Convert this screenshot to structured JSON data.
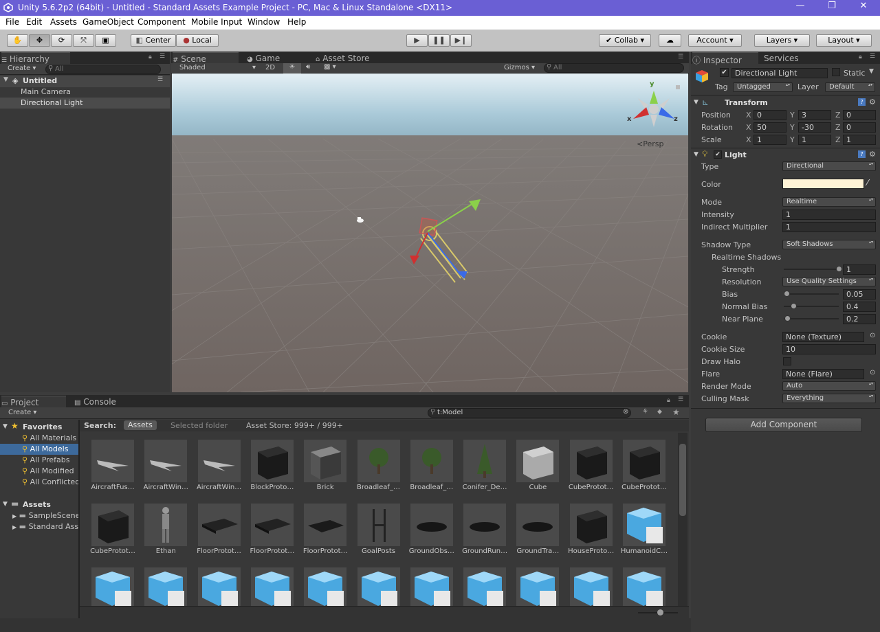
{
  "window": {
    "title": "Unity 5.6.2p2 (64bit) - Untitled - Standard Assets Example Project - PC, Mac & Linux Standalone <DX11>",
    "minimize": "—",
    "maximize": "❐",
    "close": "✕"
  },
  "menubar": [
    "File",
    "Edit",
    "Assets",
    "GameObject",
    "Component",
    "Mobile Input",
    "Window",
    "Help"
  ],
  "toolbar": {
    "pivot": "Center",
    "space": "Local",
    "collab": "Collab",
    "account": "Account",
    "layers": "Layers",
    "layout": "Layout"
  },
  "hierarchy": {
    "tab": "Hierarchy",
    "create": "Create",
    "search_placeholder": "All",
    "scene": "Untitled",
    "items": [
      "Main Camera",
      "Directional Light"
    ],
    "selected": "Directional Light"
  },
  "scene": {
    "tabs": [
      "Scene",
      "Game",
      "Asset Store"
    ],
    "shading": "Shaded",
    "mode_2d": "2D",
    "gizmos": "Gizmos",
    "search_placeholder": "All",
    "projection": "Persp",
    "axes": {
      "x": "x",
      "y": "y",
      "z": "z"
    }
  },
  "inspector": {
    "tabs": [
      "Inspector",
      "Services"
    ],
    "object_name": "Directional Light",
    "static_label": "Static",
    "tag_label": "Tag",
    "tag_value": "Untagged",
    "layer_label": "Layer",
    "layer_value": "Default",
    "transform": {
      "title": "Transform",
      "rows": [
        {
          "label": "Position",
          "x": "0",
          "y": "3",
          "z": "0"
        },
        {
          "label": "Rotation",
          "x": "50",
          "y": "-30",
          "z": "0"
        },
        {
          "label": "Scale",
          "x": "1",
          "y": "1",
          "z": "1"
        }
      ]
    },
    "light": {
      "title": "Light",
      "type_label": "Type",
      "type_value": "Directional",
      "color_label": "Color",
      "color_value": "#fff4d6",
      "mode_label": "Mode",
      "mode_value": "Realtime",
      "intensity_label": "Intensity",
      "intensity_value": "1",
      "indirect_label": "Indirect Multiplier",
      "indirect_value": "1",
      "shadow_type_label": "Shadow Type",
      "shadow_type_value": "Soft Shadows",
      "realtime_shadows": "Realtime Shadows",
      "strength_label": "Strength",
      "strength_value": "1",
      "strength_fraction": 1.0,
      "resolution_label": "Resolution",
      "resolution_value": "Use Quality Settings",
      "bias_label": "Bias",
      "bias_value": "0.05",
      "bias_fraction": 0.0025,
      "normal_bias_label": "Normal Bias",
      "normal_bias_value": "0.4",
      "normal_bias_fraction": 0.13,
      "near_plane_label": "Near Plane",
      "near_plane_value": "0.2",
      "near_plane_fraction": 0.01,
      "cookie_label": "Cookie",
      "cookie_value": "None (Texture)",
      "cookie_size_label": "Cookie Size",
      "cookie_size_value": "10",
      "draw_halo_label": "Draw Halo",
      "flare_label": "Flare",
      "flare_value": "None (Flare)",
      "render_mode_label": "Render Mode",
      "render_mode_value": "Auto",
      "culling_mask_label": "Culling Mask",
      "culling_mask_value": "Everything"
    },
    "add_component": "Add Component"
  },
  "project": {
    "tabs": [
      "Project",
      "Console"
    ],
    "create": "Create",
    "search_value": "t:Model",
    "search_label": "Search:",
    "scope_assets": "Assets",
    "scope_selected": "Selected folder",
    "asset_store": "Asset Store: 999+ / 999+",
    "favorites_label": "Favorites",
    "favorites": [
      "All Materials",
      "All Models",
      "All Prefabs",
      "All Modified",
      "All Conflicted"
    ],
    "selected_favorite": "All Models",
    "assets_label": "Assets",
    "folders": [
      "SampleScenes",
      "Standard Assets"
    ],
    "assets_row1": [
      "AircraftFus…",
      "AircraftWin…",
      "AircraftWin…",
      "BlockProto…",
      "Brick",
      "Broadleaf_…",
      "Broadleaf_…",
      "Conifer_De…",
      "Cube",
      "CubeProtot…",
      "CubeProtot…"
    ],
    "assets_row2": [
      "CubeProtot…",
      "Ethan",
      "FloorProtot…",
      "FloorProtot…",
      "FloorProtot…",
      "GoalPosts",
      "GroundObs…",
      "GroundRun…",
      "GroundTra…",
      "HouseProto…",
      "HumanoidC…"
    ]
  }
}
